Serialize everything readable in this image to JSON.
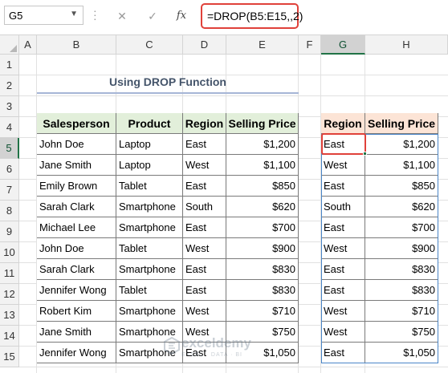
{
  "formula_bar": {
    "name_box": "G5",
    "cancel_icon": "close-icon",
    "enter_icon": "checkmark-icon",
    "function_icon": "fx",
    "formula": "=DROP(B5:E15,,2)"
  },
  "columns": [
    "A",
    "B",
    "C",
    "D",
    "E",
    "F",
    "G",
    "H"
  ],
  "rows": [
    "1",
    "2",
    "3",
    "4",
    "5",
    "6",
    "7",
    "8",
    "9",
    "10",
    "11",
    "12",
    "13",
    "14",
    "15"
  ],
  "selected_cell": {
    "column": "G",
    "row": "5"
  },
  "title": "Using DROP Function",
  "source_table": {
    "headers": [
      "Salesperson",
      "Product",
      "Region",
      "Selling Price"
    ],
    "rows": [
      [
        "John Doe",
        "Laptop",
        "East",
        "$1,200"
      ],
      [
        "Jane Smith",
        "Laptop",
        "West",
        "$1,100"
      ],
      [
        "Emily Brown",
        "Tablet",
        "East",
        "$850"
      ],
      [
        "Sarah Clark",
        "Smartphone",
        "South",
        "$620"
      ],
      [
        "Michael Lee",
        "Smartphone",
        "East",
        "$700"
      ],
      [
        "John Doe",
        "Tablet",
        "West",
        "$900"
      ],
      [
        "Sarah Clark",
        "Smartphone",
        "East",
        "$830"
      ],
      [
        "Jennifer Wong",
        "Tablet",
        "East",
        "$830"
      ],
      [
        "Robert Kim",
        "Smartphone",
        "West",
        "$710"
      ],
      [
        "Jane Smith",
        "Smartphone",
        "West",
        "$750"
      ],
      [
        "Jennifer Wong",
        "Smartphone",
        "East",
        "$1,050"
      ]
    ]
  },
  "result_table": {
    "headers": [
      "Region",
      "Selling Price"
    ],
    "rows": [
      [
        "East",
        "$1,200"
      ],
      [
        "West",
        "$1,100"
      ],
      [
        "East",
        "$850"
      ],
      [
        "South",
        "$620"
      ],
      [
        "East",
        "$700"
      ],
      [
        "West",
        "$900"
      ],
      [
        "East",
        "$830"
      ],
      [
        "East",
        "$830"
      ],
      [
        "West",
        "$710"
      ],
      [
        "West",
        "$750"
      ],
      [
        "East",
        "$1,050"
      ]
    ]
  },
  "watermark": {
    "name": "exceldemy",
    "tagline": "EXCEL · DATA · BI"
  },
  "colors": {
    "source_header_bg": "#e2efda",
    "result_header_bg": "#fce4d6",
    "highlight_border": "#e0413a",
    "spill_border": "#4a86c8",
    "title_color": "#44546a"
  }
}
